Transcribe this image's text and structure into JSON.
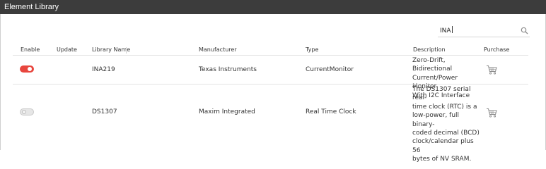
{
  "window": {
    "title": "Element Library"
  },
  "search": {
    "value": "INA",
    "icon": "search-icon"
  },
  "table": {
    "columns": [
      "Enable",
      "Update",
      "Library Name",
      "Manufacturer",
      "Type",
      "Description",
      "Purchase"
    ],
    "rows": [
      {
        "enabled": true,
        "library_name": "INA219",
        "manufacturer": "Texas Instruments",
        "type": "CurrentMonitor",
        "description_lines": [
          "Zero-Drift, Bidirectional",
          "Current/Power Monitor",
          "With I2C Interface"
        ],
        "purchase_icon": "cart-icon"
      },
      {
        "enabled": false,
        "library_name": "DS1307",
        "manufacturer": "Maxim Integrated",
        "type": "Real Time Clock",
        "description_lines": [
          "The DS1307 serial real-",
          "time clock (RTC) is a",
          "low-power, full binary-",
          "coded decimal (BCD)",
          "clock/calendar plus 56",
          "bytes of NV SRAM."
        ],
        "purchase_icon": "cart-icon"
      }
    ]
  },
  "colors": {
    "titlebar": "#3c3c3c",
    "toggle_on": "#e8463e",
    "icon": "#8a8a8a"
  }
}
